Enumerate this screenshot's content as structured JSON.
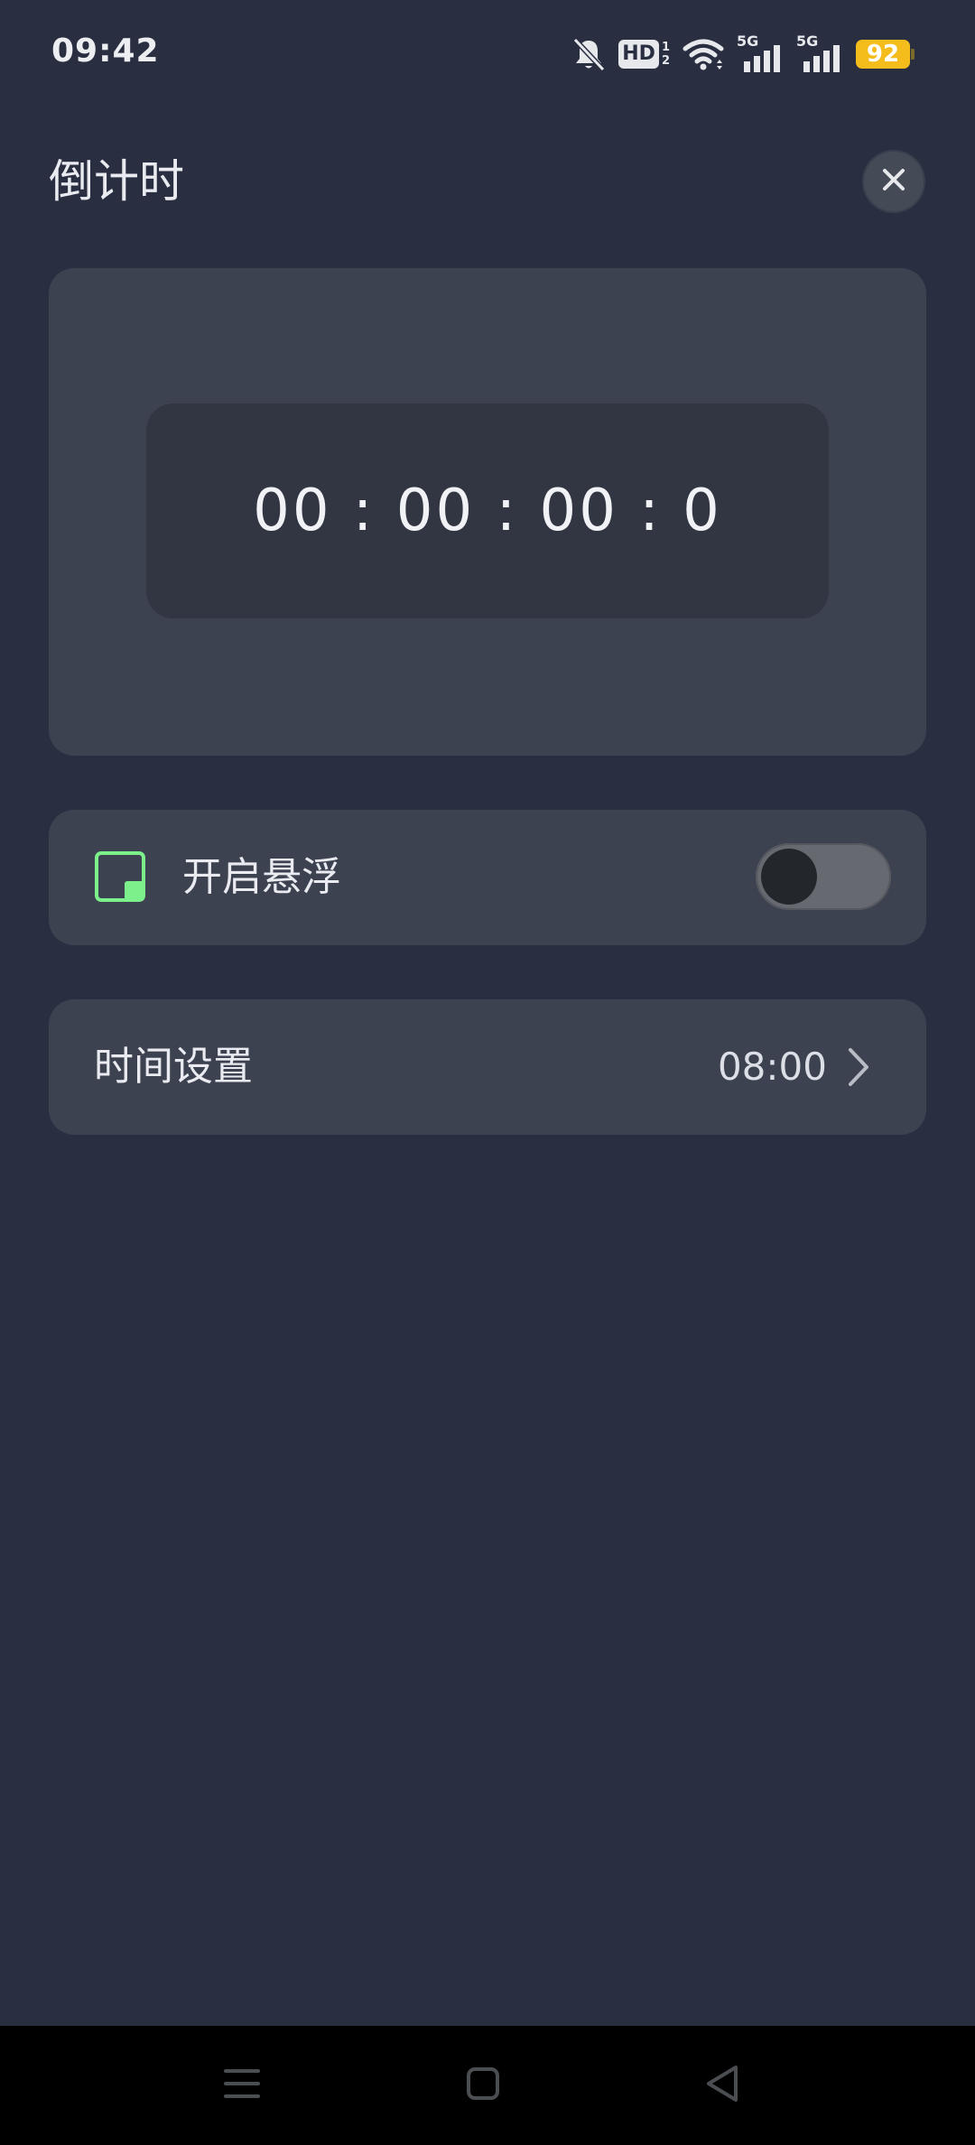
{
  "status_bar": {
    "time": "09:42",
    "hd_label": "HD",
    "hd_sub_top": "1",
    "hd_sub_bottom": "2",
    "signal1_label": "5G",
    "signal2_label": "5G",
    "battery_level": "92",
    "icons": [
      "bell-off-icon",
      "hd-icon",
      "wifi-icon",
      "signal-icon",
      "signal-icon",
      "battery-icon"
    ]
  },
  "header": {
    "title": "倒计时",
    "close_icon": "close-icon"
  },
  "timer": {
    "display": "00 : 00 : 00 : 0"
  },
  "float_setting": {
    "icon": "floating-window-icon",
    "label": "开启悬浮",
    "enabled": false
  },
  "time_setting": {
    "label": "时间设置",
    "value": "08:00",
    "icon": "chevron-right-icon"
  },
  "nav_bar": {
    "buttons": [
      "menu-icon",
      "home-icon",
      "back-icon"
    ]
  },
  "colors": {
    "background": "#292e41",
    "card": "#3d4251",
    "timer_display": "#323542",
    "accent_green": "#7cf08a",
    "battery": "#f4bd1b",
    "toggle_track": "#666a70",
    "toggle_knob": "#23272b"
  }
}
